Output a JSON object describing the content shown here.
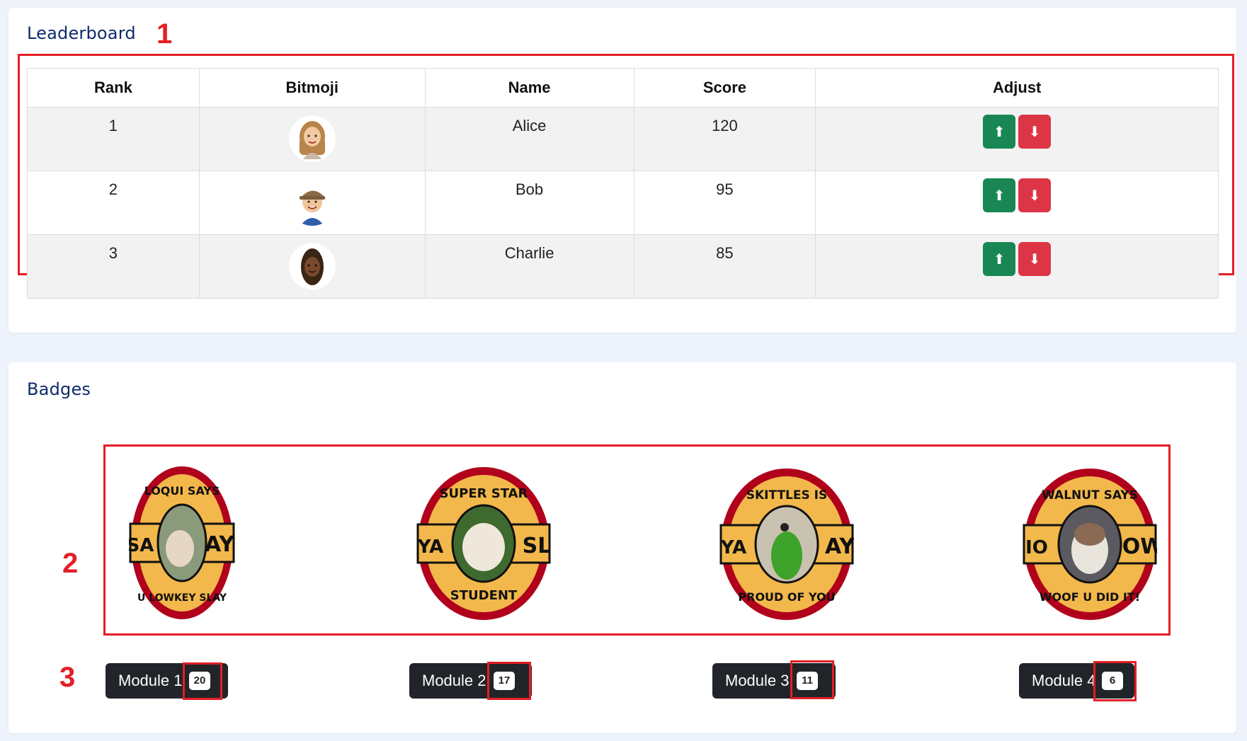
{
  "leaderboard": {
    "title": "Leaderboard",
    "headers": [
      "Rank",
      "Bitmoji",
      "Name",
      "Score",
      "Adjust"
    ],
    "rows": [
      {
        "rank": "1",
        "name": "Alice",
        "score": "120",
        "avatar_icon": "bitmoji-alice-avatar"
      },
      {
        "rank": "2",
        "name": "Bob",
        "score": "95",
        "avatar_icon": "bitmoji-bob-avatar"
      },
      {
        "rank": "3",
        "name": "Charlie",
        "score": "85",
        "avatar_icon": "bitmoji-charlie-avatar"
      }
    ],
    "up_icon": "arrow-up-icon",
    "down_icon": "arrow-down-icon",
    "up_glyph": "⬆",
    "down_glyph": "⬇"
  },
  "badges": {
    "title": "Badges",
    "items": [
      {
        "ring_text_top": "LOQUI SAYS",
        "ring_text_bottom": "U LOWKEY SLAY",
        "side_left": "SA",
        "side_right": "AY"
      },
      {
        "ring_text_top": "SUPER STAR",
        "ring_text_bottom": "STUDENT",
        "side_left": "YA",
        "side_right": "SL"
      },
      {
        "ring_text_top": "SKITTLES IS",
        "ring_text_bottom": "PROUD OF YOU",
        "side_left": "YA",
        "side_right": "AY"
      },
      {
        "ring_text_top": "WALNUT SAYS",
        "ring_text_bottom": "WOOF U DID IT!",
        "side_left": "IO",
        "side_right": "OW"
      }
    ],
    "modules": [
      {
        "label": "Module 1",
        "count": "20"
      },
      {
        "label": "Module 2",
        "count": "17"
      },
      {
        "label": "Module 3",
        "count": "11"
      },
      {
        "label": "Module 4",
        "count": "6"
      }
    ]
  },
  "annotations": {
    "one": "1",
    "two": "2",
    "three": "3"
  },
  "colors": {
    "title": "#0d2b6b",
    "annotation": "#e41e26",
    "up_button": "#198754",
    "down_button": "#dc3545",
    "pill": "#212529",
    "badge_ring": "#f2b84b",
    "badge_border": "#b1001c"
  }
}
